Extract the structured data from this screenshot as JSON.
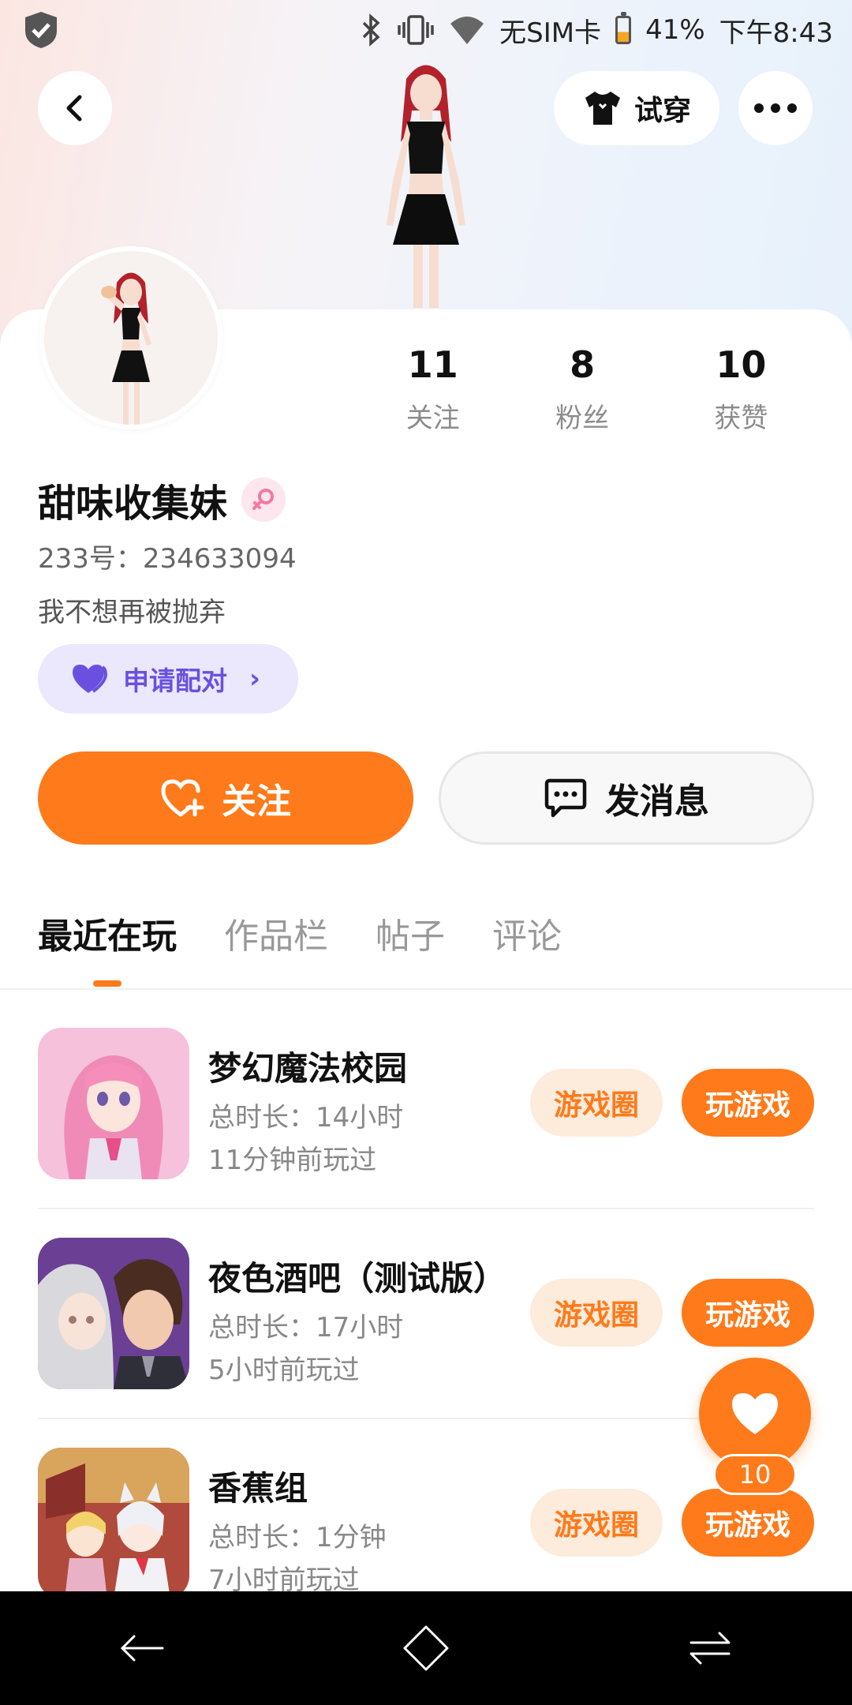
{
  "status_bar": {
    "sim": "无SIM卡",
    "battery": "41%",
    "time": "下午8:43"
  },
  "header": {
    "tryon_label": "试穿"
  },
  "profile": {
    "stats": [
      {
        "num": "11",
        "label": "关注"
      },
      {
        "num": "8",
        "label": "粉丝"
      },
      {
        "num": "10",
        "label": "获赞"
      }
    ],
    "name": "甜味收集妹",
    "uid": "233号：234633094",
    "bio": "我不想再被抛弃",
    "pair_label": "申请配对"
  },
  "actions": {
    "follow_label": "关注",
    "message_label": "发消息"
  },
  "tabs": [
    "最近在玩",
    "作品栏",
    "帖子",
    "评论"
  ],
  "games": [
    {
      "title": "梦幻魔法校园",
      "duration": "总时长：14小时",
      "last": "11分钟前玩过",
      "circle": "游戏圈",
      "play": "玩游戏"
    },
    {
      "title": "夜色酒吧（测试版）",
      "duration": "总时长：17小时",
      "last": "5小时前玩过",
      "circle": "游戏圈",
      "play": "玩游戏"
    },
    {
      "title": "香蕉组",
      "duration": "总时长：1分钟",
      "last": "7小时前玩过",
      "circle": "游戏圈",
      "play": "玩游戏"
    }
  ],
  "fab": {
    "count": "10"
  },
  "colors": {
    "accent": "#ff7a1a",
    "pair_bg": "#ebe7fd",
    "pair_text": "#6b50e0"
  },
  "icons": [
    "shield-check-icon",
    "bluetooth-icon",
    "vibrate-icon",
    "wifi-icon",
    "battery-icon",
    "back-arrow-icon",
    "tshirt-icon",
    "more-dots-icon",
    "gender-female-icon",
    "heart-pair-icon",
    "heart-plus-icon",
    "chat-bubble-icon",
    "heart-icon",
    "nav-back-icon",
    "nav-home-icon",
    "nav-recents-icon"
  ]
}
